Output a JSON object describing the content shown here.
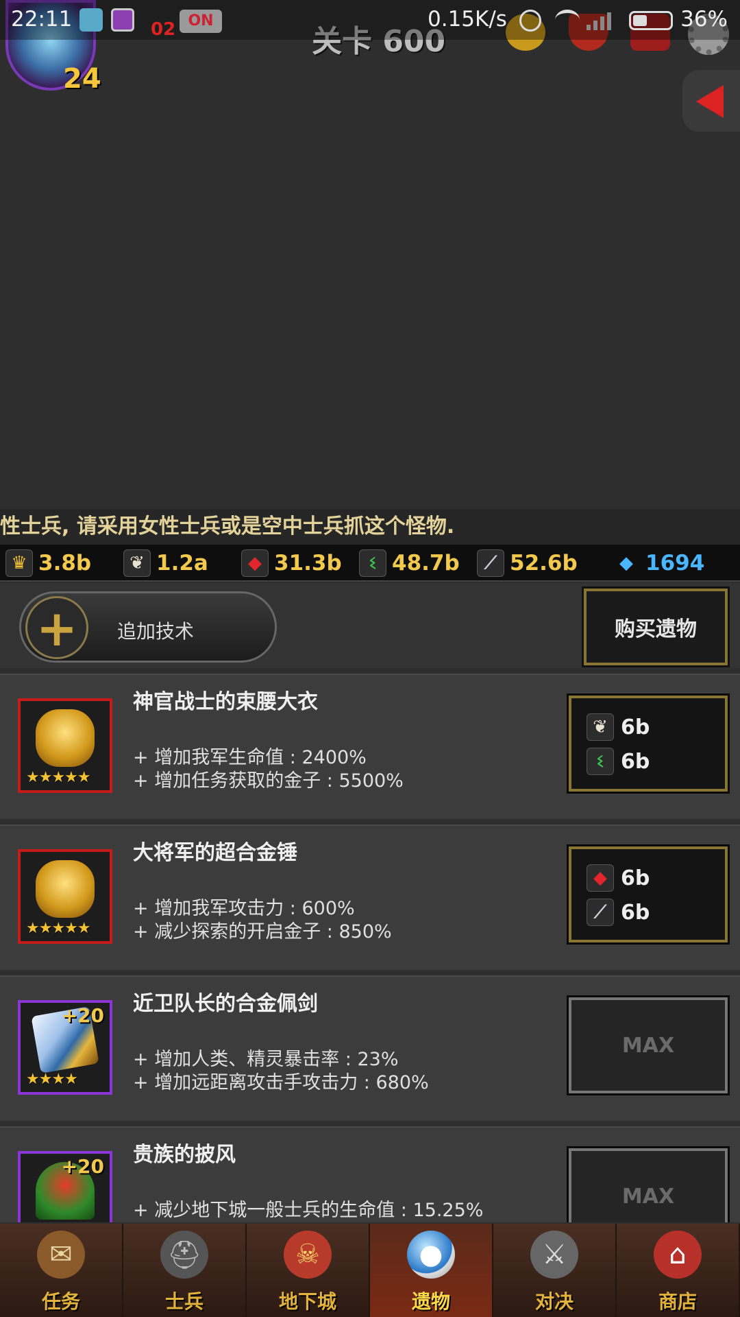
{
  "status_bar": {
    "time": "22:11",
    "on_badge": "ON",
    "small_number": "02",
    "net_speed": "0.15K/s",
    "battery": "36%"
  },
  "header": {
    "player_level": "24",
    "stage": "关卡 600"
  },
  "ticker": {
    "text": "性士兵, 请采用女性士兵或是空中士兵抓这个怪物."
  },
  "resources": [
    {
      "icon": "crown-icon",
      "value": "3.8b"
    },
    {
      "icon": "feather-icon",
      "value": "1.2a"
    },
    {
      "icon": "ruby-icon",
      "value": "31.3b"
    },
    {
      "icon": "vine-icon",
      "value": "48.7b"
    },
    {
      "icon": "claw-icon",
      "value": "52.6b"
    },
    {
      "icon": "diamond-icon",
      "value": "1694"
    }
  ],
  "actions": {
    "add_skill": "追加技术",
    "buy_relic": "购买遗物"
  },
  "relics": [
    {
      "name": "神官战士的束腰大衣",
      "effects": [
        "+ 增加我军生命值 : 2400%",
        "+ 增加任务获取的金子 : 5500%"
      ],
      "stars": "★★★★★",
      "cost": [
        {
          "icon": "feather-icon",
          "value": "6b"
        },
        {
          "icon": "vine-icon",
          "value": "6b"
        }
      ]
    },
    {
      "name": "大将军的超合金锤",
      "effects": [
        "+ 增加我军攻击力 : 600%",
        "+ 减少探索的开启金子 : 850%"
      ],
      "stars": "★★★★★",
      "cost": [
        {
          "icon": "ruby-icon",
          "value": "6b"
        },
        {
          "icon": "claw-icon",
          "value": "6b"
        }
      ]
    },
    {
      "name": "近卫队长的合金佩剑",
      "plus": "+20",
      "effects": [
        "+ 增加人类、精灵暴击率 : 23%",
        "+ 增加远距离攻击手攻击力 : 680%"
      ],
      "stars": "★★★★",
      "max_label": "MAX"
    },
    {
      "name": "贵族的披风",
      "plus": "+20",
      "effects": [
        "+ 减少地下城一般士兵的生命值 : 15.25%"
      ],
      "stars": "★★★★",
      "max_label": "MAX"
    }
  ],
  "nav": [
    {
      "label": "任务",
      "icon": "scroll-icon"
    },
    {
      "label": "士兵",
      "icon": "helmet-icon"
    },
    {
      "label": "地下城",
      "icon": "monster-icon"
    },
    {
      "label": "遗物",
      "icon": "orb-icon",
      "active": true
    },
    {
      "label": "对决",
      "icon": "crossed-swords-icon"
    },
    {
      "label": "商店",
      "icon": "shop-icon"
    }
  ]
}
